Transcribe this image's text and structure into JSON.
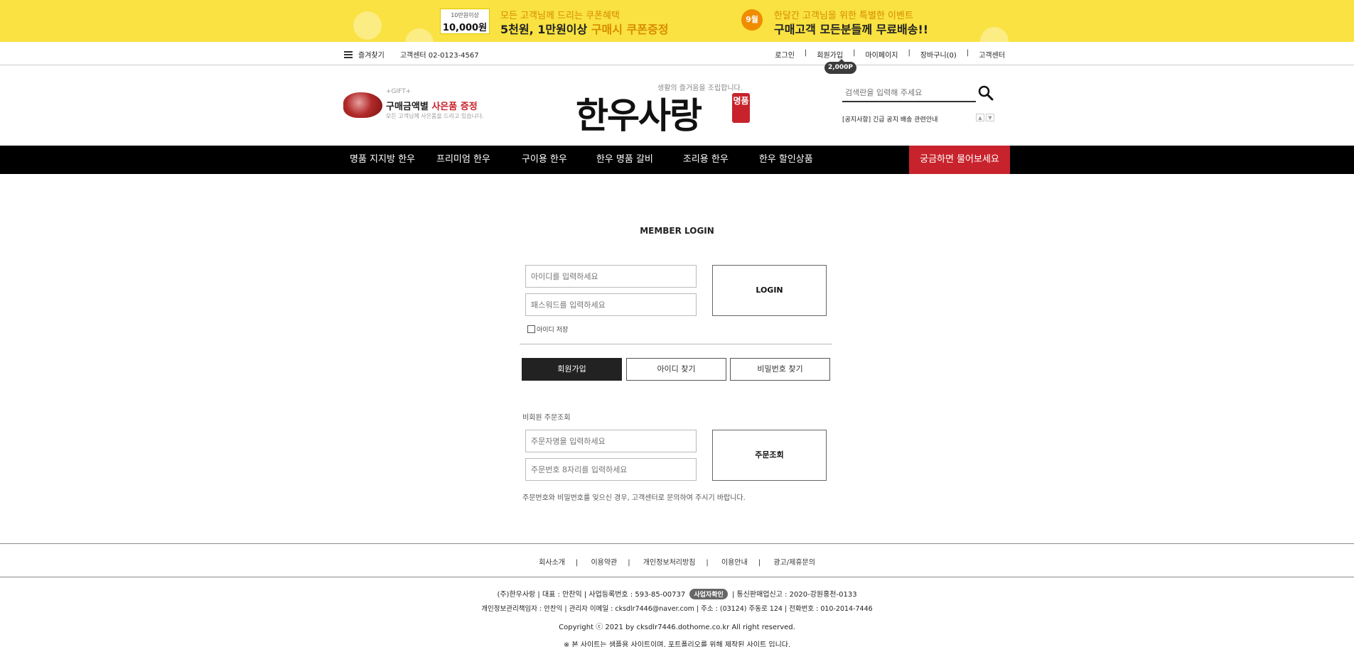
{
  "banner": {
    "coupon_small": "10만원이상",
    "coupon_big": "10,000원",
    "promo1_line1": "모든 고객님께 드리는 쿠폰혜택",
    "promo1_line2_main": "5천원, 1만원이상 ",
    "promo1_line2_highlight": "구매시 쿠폰증정",
    "month_badge": "9월",
    "promo2_line1": "한달간 고객님을 위한 특별한 이벤트",
    "promo2_line2": "구매고객 모든분들께 무료배송!!",
    "bg_color": "#f9e241",
    "accent_color": "#d98b00"
  },
  "util": {
    "bookmark": "즐겨찾기",
    "cs_phone": "고객센터 02-0123-4567",
    "links": [
      "로그인",
      "회원가입",
      "마이페이지",
      "장바구니(0)",
      "고객센터"
    ],
    "point_badge": "2,000P"
  },
  "header": {
    "gift_tag": "+GIFT+",
    "gift_main": "구매금액별 ",
    "gift_highlight": "사은품 증정",
    "gift_sub": "모든 고객님께 사은품을 드리고 있습니다.",
    "logo_tagline": "생활의 즐거움을 조립합니다.",
    "logo_text": "한우사랑",
    "logo_seal": "명품",
    "search_placeholder": "검색란을 입력해 주세요",
    "notice": "[공지사항] 긴급 공지 배송 관련안내"
  },
  "nav": {
    "items": [
      "명품 지지방 한우",
      "프리미엄 한우",
      "구이용 한우",
      "한우 명품 갈비",
      "조리용 한우",
      "한우 할인상품"
    ],
    "cta": "궁금하면 물어보세요",
    "cta_color": "#c8232c"
  },
  "login": {
    "title": "MEMBER LOGIN",
    "id_placeholder": "아이디를 입력하세요",
    "pw_placeholder": "패스워드를 입력하세요",
    "login_button": "LOGIN",
    "save_id": "아이디 저장",
    "join_button": "회원가입",
    "find_id_button": "아이디 찾기",
    "find_pw_button": "비밀번호 찾기"
  },
  "guest": {
    "title": "비회원 주문조회",
    "name_placeholder": "주문자명을 입력하세요",
    "order_placeholder": "주문번호 8자리를 입력하세요",
    "button": "주문조회",
    "note": "주문번호와 비밀번호를 잊으신 경우, 고객센터로 문의하여 주시기 바랍니다."
  },
  "footer": {
    "links": [
      "회사소개",
      "이용약관",
      "개인정보처리방침",
      "이용안내",
      "광고/제휴문의"
    ],
    "line1_before": "(주)한우사랑 | 대표 : 안찬익 | 사업등록번호 : 593-85-00737",
    "biz_badge": "사업자확인",
    "line1_after": "| 통신판매업신고 : 2020-강원홍천-0133",
    "line2": "개인정보관리책임자 : 안찬익 | 관리자 이메일 : cksdlr7446@naver.com | 주소 : (03124) 주동로 124 | 전화번호 : 010-2014-7446",
    "copyright": "Copyright ⓒ 2021 by cksdlr7446.dothome.co.kr All right reserved.",
    "disclaimer": "※ 본 사이트는 샘플용 사이트이며, 포트폴리오를 위해 제작된 사이트 입니다."
  }
}
